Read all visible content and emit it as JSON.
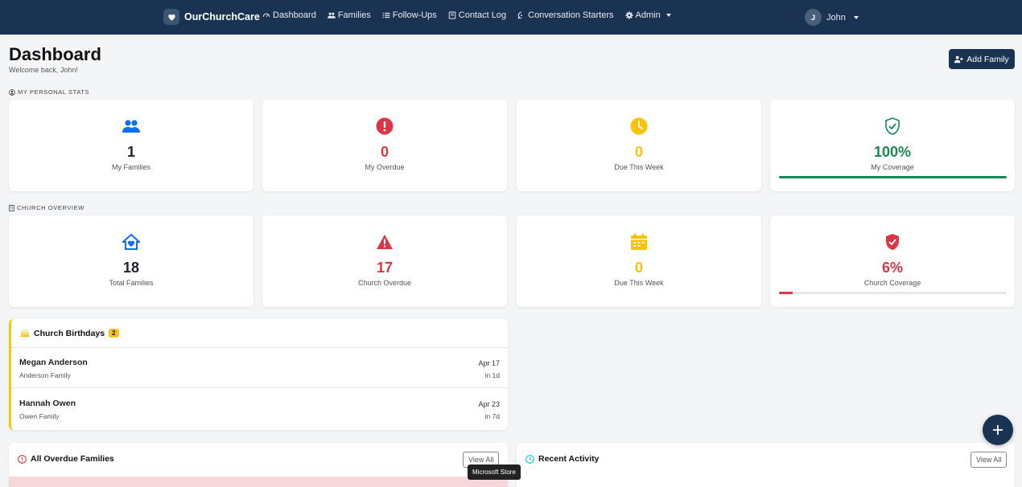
{
  "nav": {
    "brand": "OurChurchCare",
    "items": [
      {
        "label": "Dashboard",
        "icon": "gauge-icon"
      },
      {
        "label": "Families",
        "icon": "users-icon"
      },
      {
        "label": "Follow-Ups",
        "icon": "list-icon"
      },
      {
        "label": "Contact Log",
        "icon": "journal-icon"
      },
      {
        "label": "Conversation Starters",
        "icon": "chat-icon"
      },
      {
        "label": "Admin",
        "icon": "gear-icon"
      }
    ],
    "user": {
      "initial": "J",
      "name": "John"
    }
  },
  "header": {
    "title": "Dashboard",
    "welcome": "Welcome back, John!",
    "add_family_label": "Add Family"
  },
  "personal": {
    "section_label": "MY PERSONAL STATS",
    "cards": [
      {
        "value": "1",
        "label": "My Families",
        "color": "#212529",
        "icon": "users-icon",
        "icon_color": "#0d6efd"
      },
      {
        "value": "0",
        "label": "My Overdue",
        "color": "#dc3545",
        "icon": "exclamation-circle-icon",
        "icon_color": "#dc3545"
      },
      {
        "value": "0",
        "label": "Due This Week",
        "color": "#ffc107",
        "icon": "clock-icon",
        "icon_color": "#ffc107"
      },
      {
        "value": "100%",
        "label": "My Coverage",
        "color": "#198754",
        "icon": "shield-check-icon",
        "icon_color": "#198754",
        "progress": 1.0,
        "bar_color": "#198754"
      }
    ]
  },
  "church": {
    "section_label": "CHURCH OVERVIEW",
    "cards": [
      {
        "value": "18",
        "label": "Total Families",
        "color": "#212529",
        "icon": "house-heart-icon",
        "icon_color": "#0d6efd"
      },
      {
        "value": "17",
        "label": "Church Overdue",
        "color": "#dc3545",
        "icon": "warning-triangle-icon",
        "icon_color": "#dc3545"
      },
      {
        "value": "0",
        "label": "Due This Week",
        "color": "#ffc107",
        "icon": "calendar-week-icon",
        "icon_color": "#ffc107"
      },
      {
        "value": "6%",
        "label": "Church Coverage",
        "color": "#dc3545",
        "icon": "shield-fill-check-icon",
        "icon_color": "#dc3545",
        "progress": 0.06,
        "bar_color": "#dc3545"
      }
    ]
  },
  "birthdays": {
    "title": "Church Birthdays",
    "count": "2",
    "items": [
      {
        "name": "Megan Anderson",
        "family": "Anderson Family",
        "date": "Apr 17",
        "in": "in 1d"
      },
      {
        "name": "Hannah Owen",
        "family": "Owen Family",
        "date": "Apr 23",
        "in": "in 7d"
      }
    ]
  },
  "overdue_panel": {
    "title": "All Overdue Families",
    "view_all": "View All"
  },
  "activity_panel": {
    "title": "Recent Activity",
    "view_all": "View All"
  },
  "tooltip": "Microsoft Store"
}
